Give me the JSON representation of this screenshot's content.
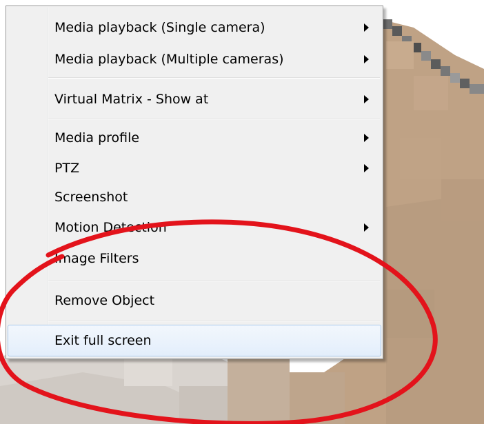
{
  "menu": {
    "items": [
      {
        "label": "Media playback (Single camera)",
        "submenu": true
      },
      {
        "label": "Media playback (Multiple cameras)",
        "submenu": true
      },
      {
        "label": "Virtual Matrix - Show at",
        "submenu": true
      },
      {
        "label": "Media profile",
        "submenu": true
      },
      {
        "label": "PTZ",
        "submenu": true
      },
      {
        "label": "Screenshot",
        "submenu": false
      },
      {
        "label": "Motion Detection",
        "submenu": true
      },
      {
        "label": "Image Filters",
        "submenu": false
      },
      {
        "label": "Remove Object",
        "submenu": false
      },
      {
        "label": "Exit full screen",
        "submenu": false,
        "highlighted": true
      }
    ]
  },
  "colors": {
    "annotation": "#e3131b",
    "menu_background": "#f0f0f0",
    "highlight_border": "#a8c8ec",
    "camera_feed": "#bda287"
  },
  "icons": {
    "submenu": "chevron-right-icon"
  }
}
